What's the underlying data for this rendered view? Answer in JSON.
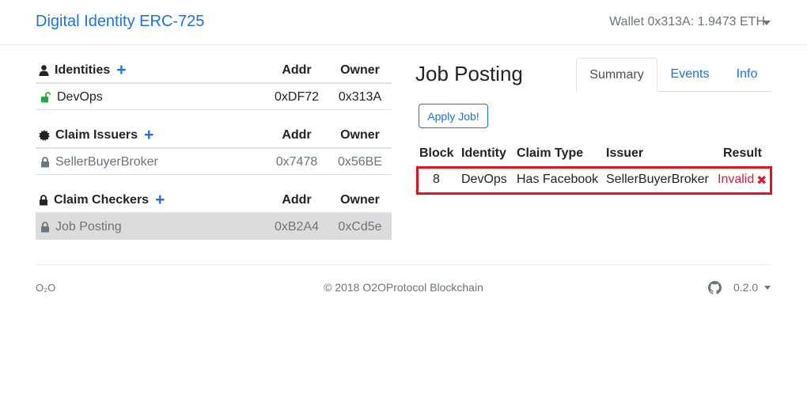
{
  "header": {
    "brand": "Digital Identity ERC-725",
    "wallet": "Wallet 0x313A: 1.9473 ETH"
  },
  "identities": {
    "title": "Identities",
    "col_addr": "Addr",
    "col_owner": "Owner",
    "rows": [
      {
        "name": "DevOps",
        "addr": "0xDF72",
        "owner": "0x313A",
        "lock": "unlocked"
      }
    ]
  },
  "claim_issuers": {
    "title": "Claim Issuers",
    "col_addr": "Addr",
    "col_owner": "Owner",
    "rows": [
      {
        "name": "SellerBuyerBroker",
        "addr": "0x7478",
        "owner": "0x56BE",
        "lock": "locked"
      }
    ]
  },
  "claim_checkers": {
    "title": "Claim Checkers",
    "col_addr": "Addr",
    "col_owner": "Owner",
    "rows": [
      {
        "name": "Job Posting",
        "addr": "0xB2A4",
        "owner": "0xCd5e",
        "lock": "locked"
      }
    ]
  },
  "detail": {
    "title": "Job Posting",
    "tabs": [
      "Summary",
      "Events",
      "Info"
    ],
    "active_tab": "Summary",
    "apply_button": "Apply Job!",
    "columns": [
      "Block",
      "Identity",
      "Claim Type",
      "Issuer",
      "Result"
    ],
    "row": {
      "block": "8",
      "identity": "DevOps",
      "claim_type": "Has Facebook",
      "issuer": "SellerBuyerBroker",
      "result": "Invalid",
      "result_icon": "✖"
    }
  },
  "footer": {
    "logo": "O₂O",
    "copyright": "© 2018  O2OProtocol Blockchain",
    "version": "0.2.0"
  },
  "colors": {
    "link": "#1a73e8",
    "danger": "#dc1e3c",
    "highlight_border": "#e8101e",
    "unlocked": "#28a745"
  }
}
